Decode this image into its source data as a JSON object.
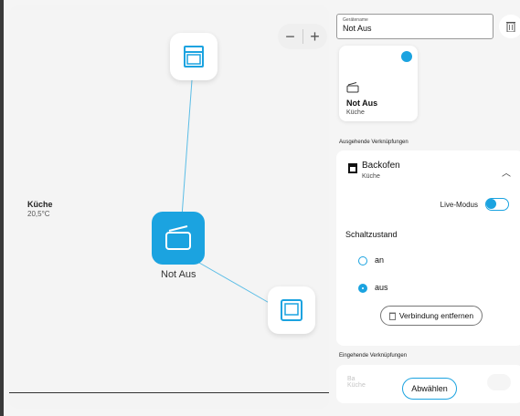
{
  "canvas": {
    "room": {
      "name": "Küche",
      "temperature": "20,5°C"
    },
    "zoom": {
      "minus": "−",
      "plus": "+"
    },
    "nodes": {
      "selected_label": "Not Aus"
    }
  },
  "panel": {
    "name_field": {
      "label": "Gerätename",
      "value": "Not Aus"
    },
    "device_card": {
      "name": "Not Aus",
      "room": "Küche"
    },
    "outgoing_title": "Ausgehende Verknüpfungen",
    "outgoing": {
      "name": "Backofen",
      "room": "Küche",
      "live_mode_label": "Live-Modus",
      "live_mode_on": true,
      "state_title": "Schaltzustand",
      "options": [
        "an",
        "aus"
      ],
      "selected": "aus",
      "remove_label": "Verbindung entfernen"
    },
    "incoming_title": "Eingehende Verknüpfungen",
    "incoming": {
      "name": "Ba",
      "room": "Küche"
    },
    "deselect_label": "Abwählen"
  },
  "colors": {
    "accent": "#1ba3e0"
  }
}
